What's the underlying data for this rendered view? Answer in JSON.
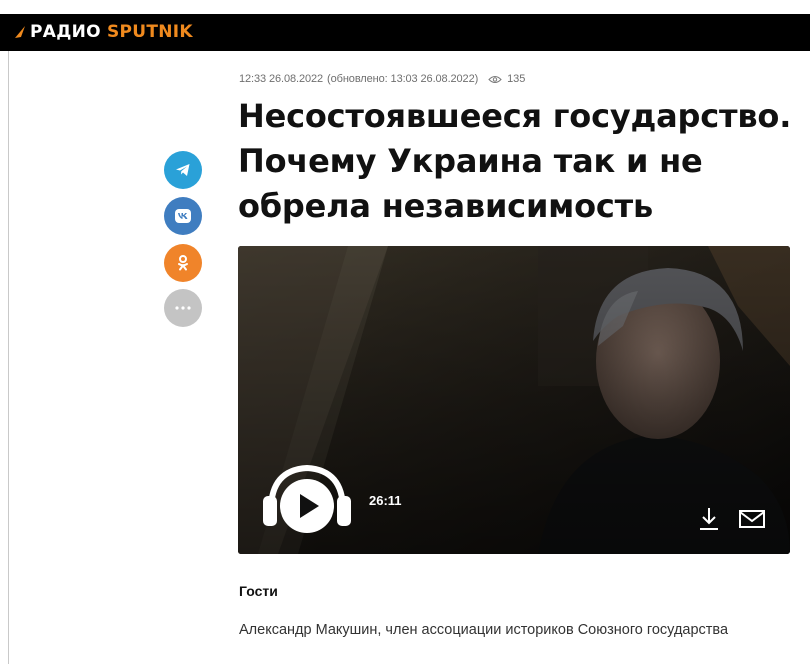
{
  "header": {
    "logo_radio": "РАДИО",
    "logo_sputnik": "SPUTNIK",
    "logo_icon": "sputnik-arrow-icon"
  },
  "share": {
    "items": [
      {
        "icon": "telegram-icon",
        "color": "#2aa1d8"
      },
      {
        "icon": "vk-icon",
        "color": "#3f7dc0"
      },
      {
        "icon": "odnoklassniki-icon",
        "color": "#f0842a"
      },
      {
        "icon": "more-icon",
        "color": "#c4c4c4"
      }
    ]
  },
  "article": {
    "published": "12:33 26.08.2022",
    "updated": "(обновлено: 13:03 26.08.2022)",
    "views": "135",
    "title": "Несостоявшееся государство. Почему Украина так и не обрела независимость"
  },
  "player": {
    "duration": "26:11",
    "icons": [
      "play-headphones-icon",
      "download-icon",
      "mail-icon"
    ]
  },
  "guests": {
    "heading": "Гости",
    "items": [
      {
        "text": "Александр Макушин, член ассоциации историков Союзного государства"
      }
    ]
  },
  "colors": {
    "accent": "#f08a1e",
    "header_bg": "#000000"
  }
}
